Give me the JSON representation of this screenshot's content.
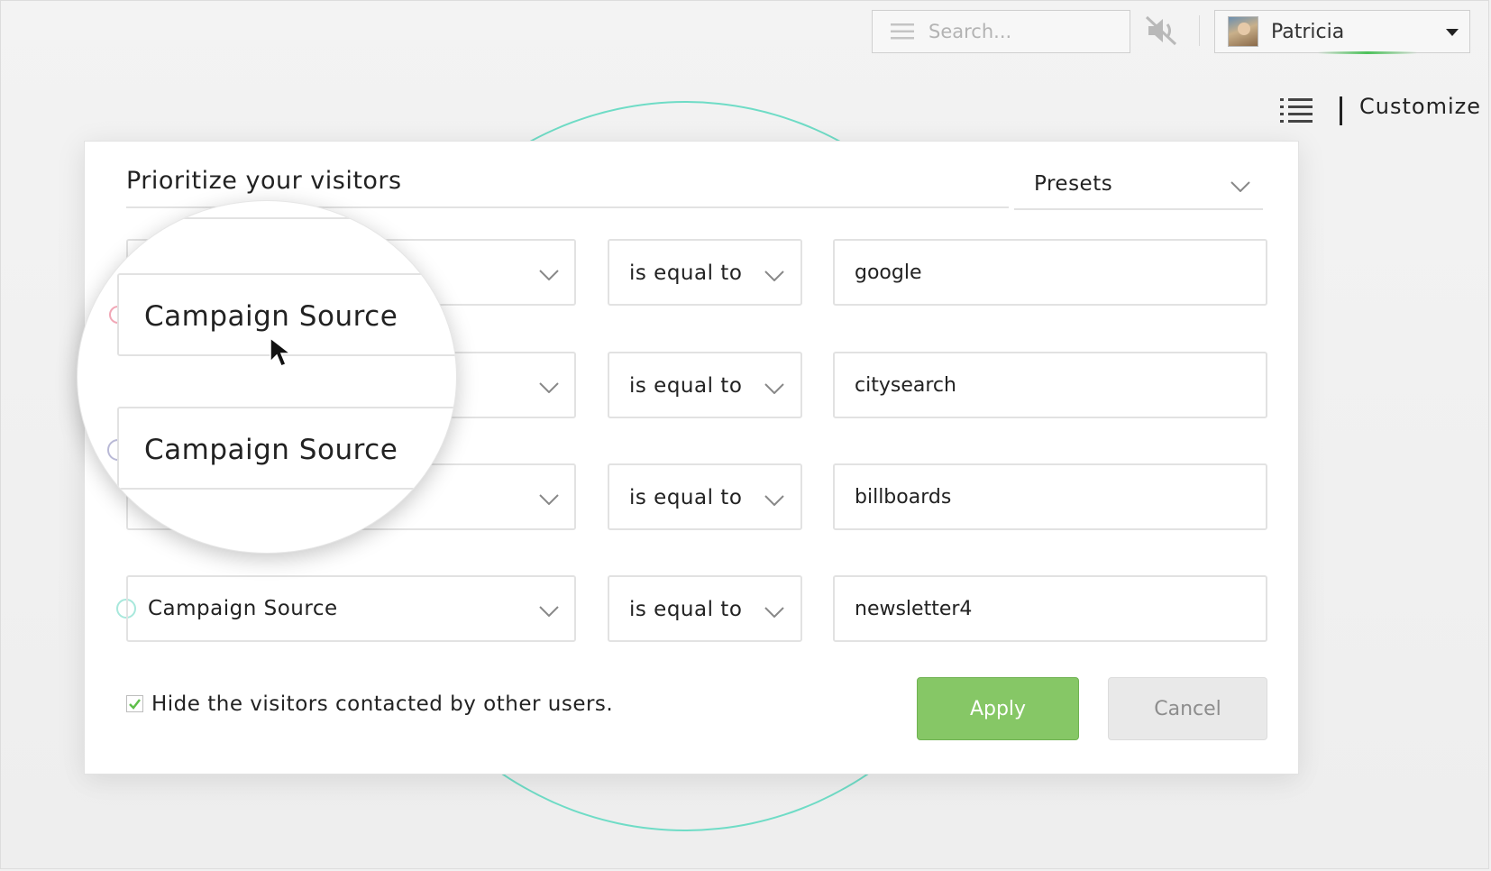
{
  "topbar": {
    "search_placeholder": "Search...",
    "user_name": "Patricia",
    "customize_label": "Customize"
  },
  "dialog": {
    "title": "Prioritize your visitors",
    "presets_label": "Presets",
    "rules": [
      {
        "field": "",
        "operator": "is equal to",
        "value": "google"
      },
      {
        "field": "",
        "operator": "is equal to",
        "value": "citysearch"
      },
      {
        "field": "",
        "operator": "is equal to",
        "value": "billboards"
      },
      {
        "field": "Campaign Source",
        "operator": "is equal to",
        "value": "newsletter4"
      }
    ],
    "hide_checkbox_checked": true,
    "hide_label": "Hide the visitors contacted by other users.",
    "apply_label": "Apply",
    "cancel_label": "Cancel"
  },
  "magnifier": {
    "field_1_label": "Campaign Source",
    "field_2_label": "Campaign Source"
  },
  "colors": {
    "accent_green": "#86c766",
    "teal_ring": "#6fdcc6",
    "dot_pink": "#f1a7b6",
    "dot_lavender": "#c9c9dc",
    "dot_teal": "#a8e8dc"
  }
}
